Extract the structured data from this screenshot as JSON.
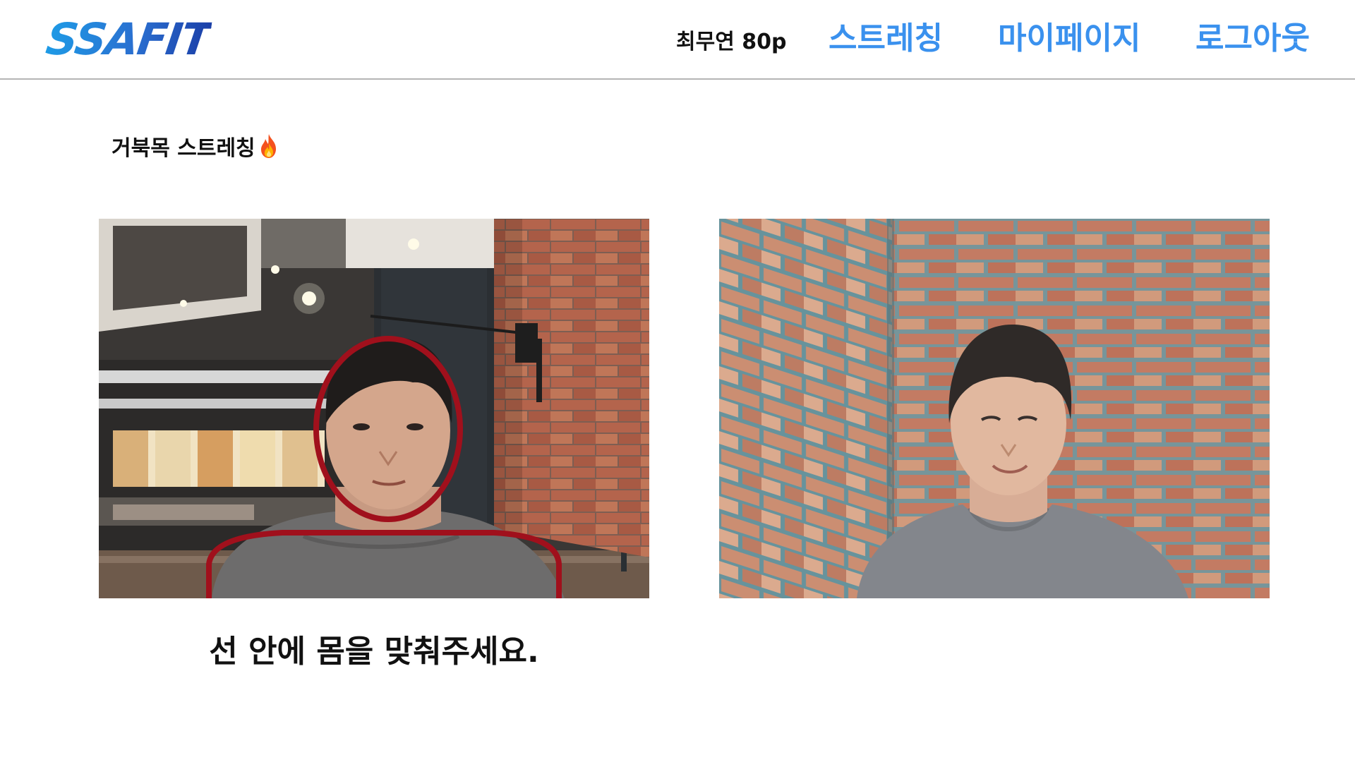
{
  "header": {
    "logo": "SSAFIT",
    "user_info": "최무연 80p",
    "nav": {
      "stretch_label": "스트레칭",
      "mypage_label": "마이페이지",
      "logout_label": "로그아웃"
    }
  },
  "main": {
    "title": "거북목 스트레칭",
    "title_icon": "fire-icon",
    "guide_text": "선 안에 몸을 맞춰주세요."
  },
  "colors": {
    "nav_link": "#3a91ee",
    "logo_gradient_start": "#1e9be6",
    "logo_gradient_end": "#1b3fa8",
    "guide_outline": "#a0101c"
  }
}
